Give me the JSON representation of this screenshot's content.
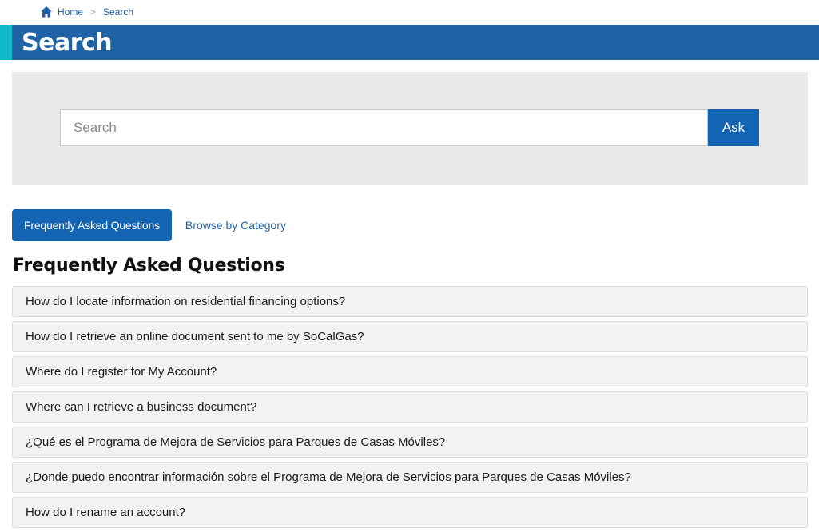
{
  "breadcrumb": {
    "home_label": "Home",
    "separator": ">",
    "current": "Search"
  },
  "page": {
    "title": "Search"
  },
  "search": {
    "placeholder": "Search",
    "value": "",
    "button_label": "Ask"
  },
  "tabs": [
    {
      "label": "Frequently Asked Questions",
      "active": true
    },
    {
      "label": "Browse by Category",
      "active": false
    }
  ],
  "faq": {
    "heading": "Frequently Asked Questions",
    "items": [
      "How do I locate information on residential financing options?",
      "How do I retrieve an online document sent to me by SoCalGas?",
      "Where do I register for My Account?",
      "Where can I retrieve a business document?",
      "¿Qué es el Programa de Mejora de Servicios para Parques de Casas Móviles?",
      "¿Donde puedo encontrar información sobre el Programa de Mejora de Servicios para Parques de Casas Móviles?",
      "How do I rename an account?"
    ]
  },
  "colors": {
    "brand_blue": "#1f63a5",
    "button_blue": "#1464b4",
    "accent_teal": "#12b6c9",
    "panel_gray": "#eaeaea"
  },
  "icons": {
    "home": "home-icon"
  }
}
